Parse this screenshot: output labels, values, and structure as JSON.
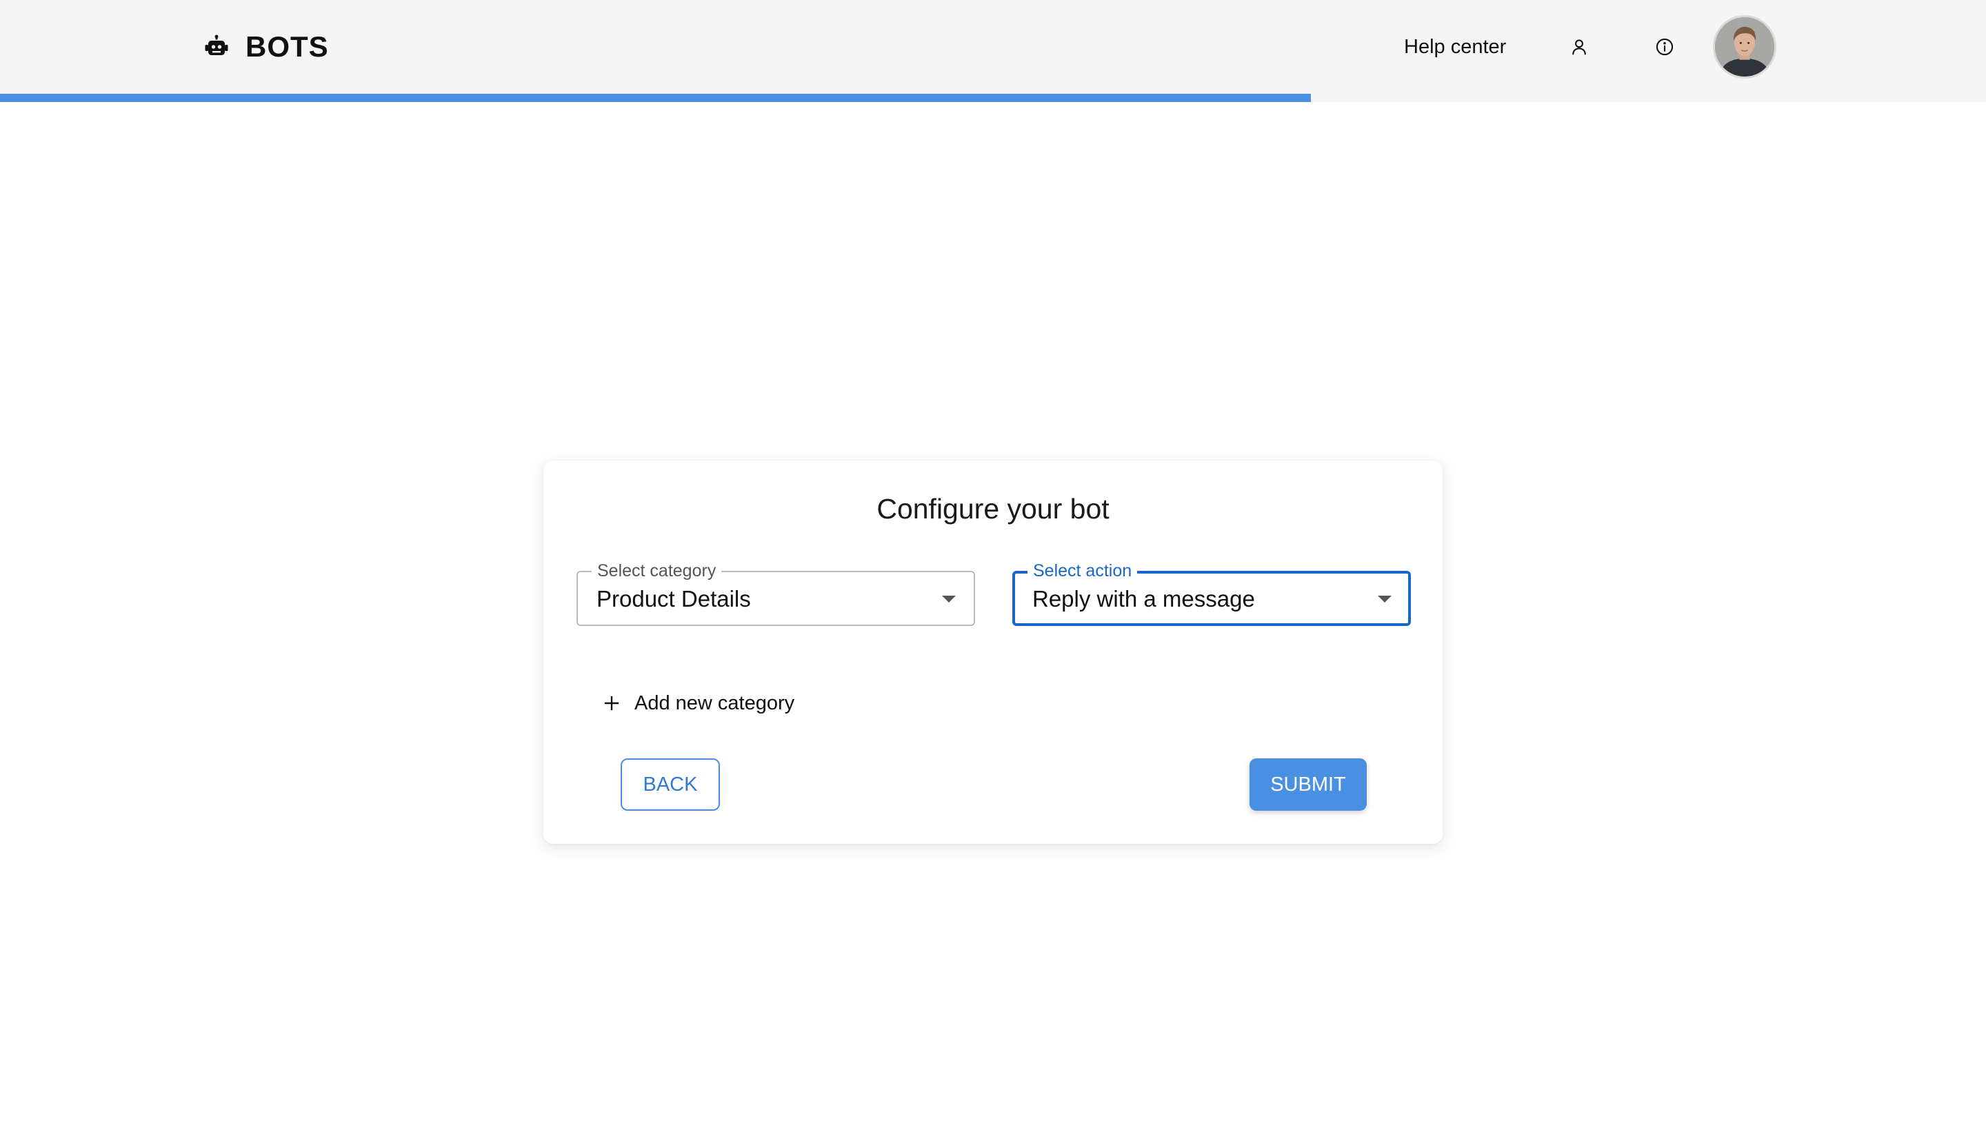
{
  "header": {
    "brand_text": "BOTS",
    "brand_icon": "robot-icon",
    "help_center_label": "Help center",
    "user_icon": "user-icon",
    "info_icon": "info-icon"
  },
  "progress": {
    "value_percent": 66
  },
  "card": {
    "title": "Configure your bot",
    "category_select": {
      "label": "Select category",
      "value": "Product Details"
    },
    "action_select": {
      "label": "Select action",
      "value": "Reply with a message"
    },
    "add_category_label": "Add new category",
    "back_label": "BACK",
    "submit_label": "SUBMIT"
  },
  "colors": {
    "accent": "#4a90e2",
    "focus": "#1a66c9",
    "header_bg": "#f5f5f5"
  }
}
